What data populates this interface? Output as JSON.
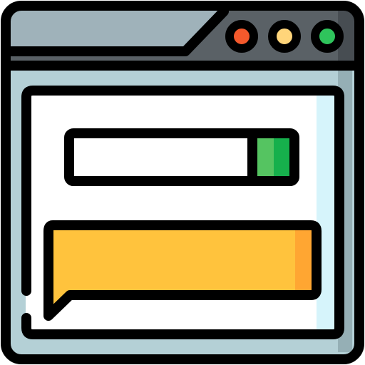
{
  "icon": {
    "name": "browser-window-search-icon",
    "colors": {
      "outline": "#000000",
      "window_frame": "#B4D0D6",
      "window_frame_shadow": "#95AFB5",
      "titlebar": "#9FB2BA",
      "titlebar_dark": "#5A6166",
      "titlebar_darker": "#474D52",
      "content_background": "#FFFFFF",
      "content_shade": "#D6F4FB",
      "search_field": "#FFFFFF",
      "search_button": "#55C461",
      "search_button_shade": "#16B04C",
      "dot_close": "#F4592C",
      "dot_minimize": "#FFD57A",
      "dot_maximize": "#2FC45C",
      "speech_bubble": "#FFC33D",
      "speech_bubble_shade": "#FFA632"
    }
  }
}
